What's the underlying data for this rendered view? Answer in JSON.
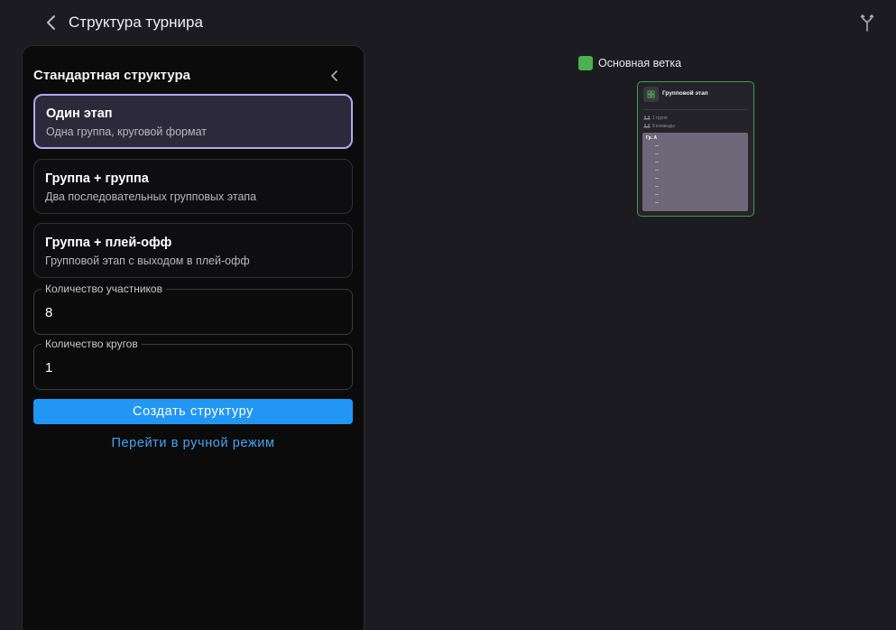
{
  "header": {
    "title": "Структура турнира",
    "back_icon": "chevron-left-icon",
    "branch_icon": "git-branch-icon"
  },
  "panel": {
    "title": "Стандартная структура",
    "collapse_icon": "chevron-left-icon",
    "options": [
      {
        "title": "Один этап",
        "description": "Одна группа, круговой формат",
        "selected": true
      },
      {
        "title": "Группа + группа",
        "description": "Два последовательных групповых этапа",
        "selected": false
      },
      {
        "title": "Группа + плей-офф",
        "description": "Групповой этап с выходом в плей-офф",
        "selected": false
      }
    ],
    "participants": {
      "label": "Количество участников",
      "value": "8"
    },
    "rounds": {
      "label": "Количество кругов",
      "value": "1"
    },
    "create_label": "Создать структуру",
    "manual_label": "Перейти в ручной режим"
  },
  "canvas": {
    "legend": {
      "label": "Основная ветка",
      "color": "#4caf50"
    },
    "stage": {
      "title": "Групповой этап",
      "icon": "grid-icon",
      "groups_count": "1 групп",
      "teams_count": "8 команды",
      "group_name": "Гр. A",
      "slots": 8,
      "border_color": "#3f9f46"
    }
  },
  "colors": {
    "accent": "#2196f3",
    "link": "#42a5f5",
    "selected_border": "#b6a6ef",
    "background": "#1c1b21",
    "panel": "#0b0b0b"
  }
}
